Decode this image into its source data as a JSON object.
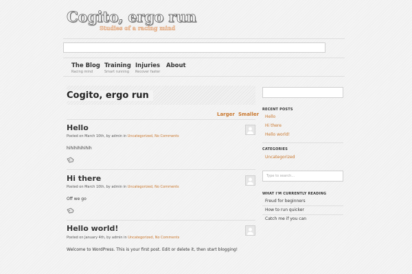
{
  "header": {
    "site_title": "Cogito, ergo run",
    "tagline": "Studies of a racing mind"
  },
  "nav": [
    {
      "label": "The Blog",
      "sub": "Racing mind"
    },
    {
      "label": "Training",
      "sub": "Smart running"
    },
    {
      "label": "Injuries",
      "sub": "Recover faster"
    },
    {
      "label": "About",
      "sub": ""
    }
  ],
  "main": {
    "page_title": "Cogito, ergo run",
    "larger_label": "Larger",
    "smaller_label": "Smaller",
    "posts": [
      {
        "title": "Hello",
        "meta_prefix": "Posted on March 10th, by admin in",
        "category": "Uncategorized,",
        "comments": "No Comments",
        "body": "hihihihihihih"
      },
      {
        "title": "Hi there",
        "meta_prefix": "Posted on March 10th, by admin in",
        "category": "Uncategorized,",
        "comments": "No Comments",
        "body": "Off we go"
      },
      {
        "title": "Hello world!",
        "meta_prefix": "Posted on January 4th, by admin in",
        "category": "Uncategorized,",
        "comments": "No Comments",
        "body": "Welcome to WordPress. This is your first post. Edit or delete it, then start blogging!"
      }
    ]
  },
  "sidebar": {
    "recent_posts_heading": "RECENT POSTS",
    "recent_posts": [
      "Hello",
      "Hi there",
      "Hello world!"
    ],
    "categories_heading": "CATEGORIES",
    "categories": [
      "Uncategorized"
    ],
    "search_placeholder": "Type to search...",
    "reading_heading": "WHAT I'M CURRENTLY READING",
    "reading": [
      "Freud for beginners",
      "How to run quicker",
      "Catch me if you can"
    ]
  },
  "colors": {
    "accent": "#c8752a",
    "background": "#f4f4f4",
    "text": "#333333"
  },
  "icons": {
    "post_tag": "tag-icon",
    "author": "avatar-icon"
  }
}
